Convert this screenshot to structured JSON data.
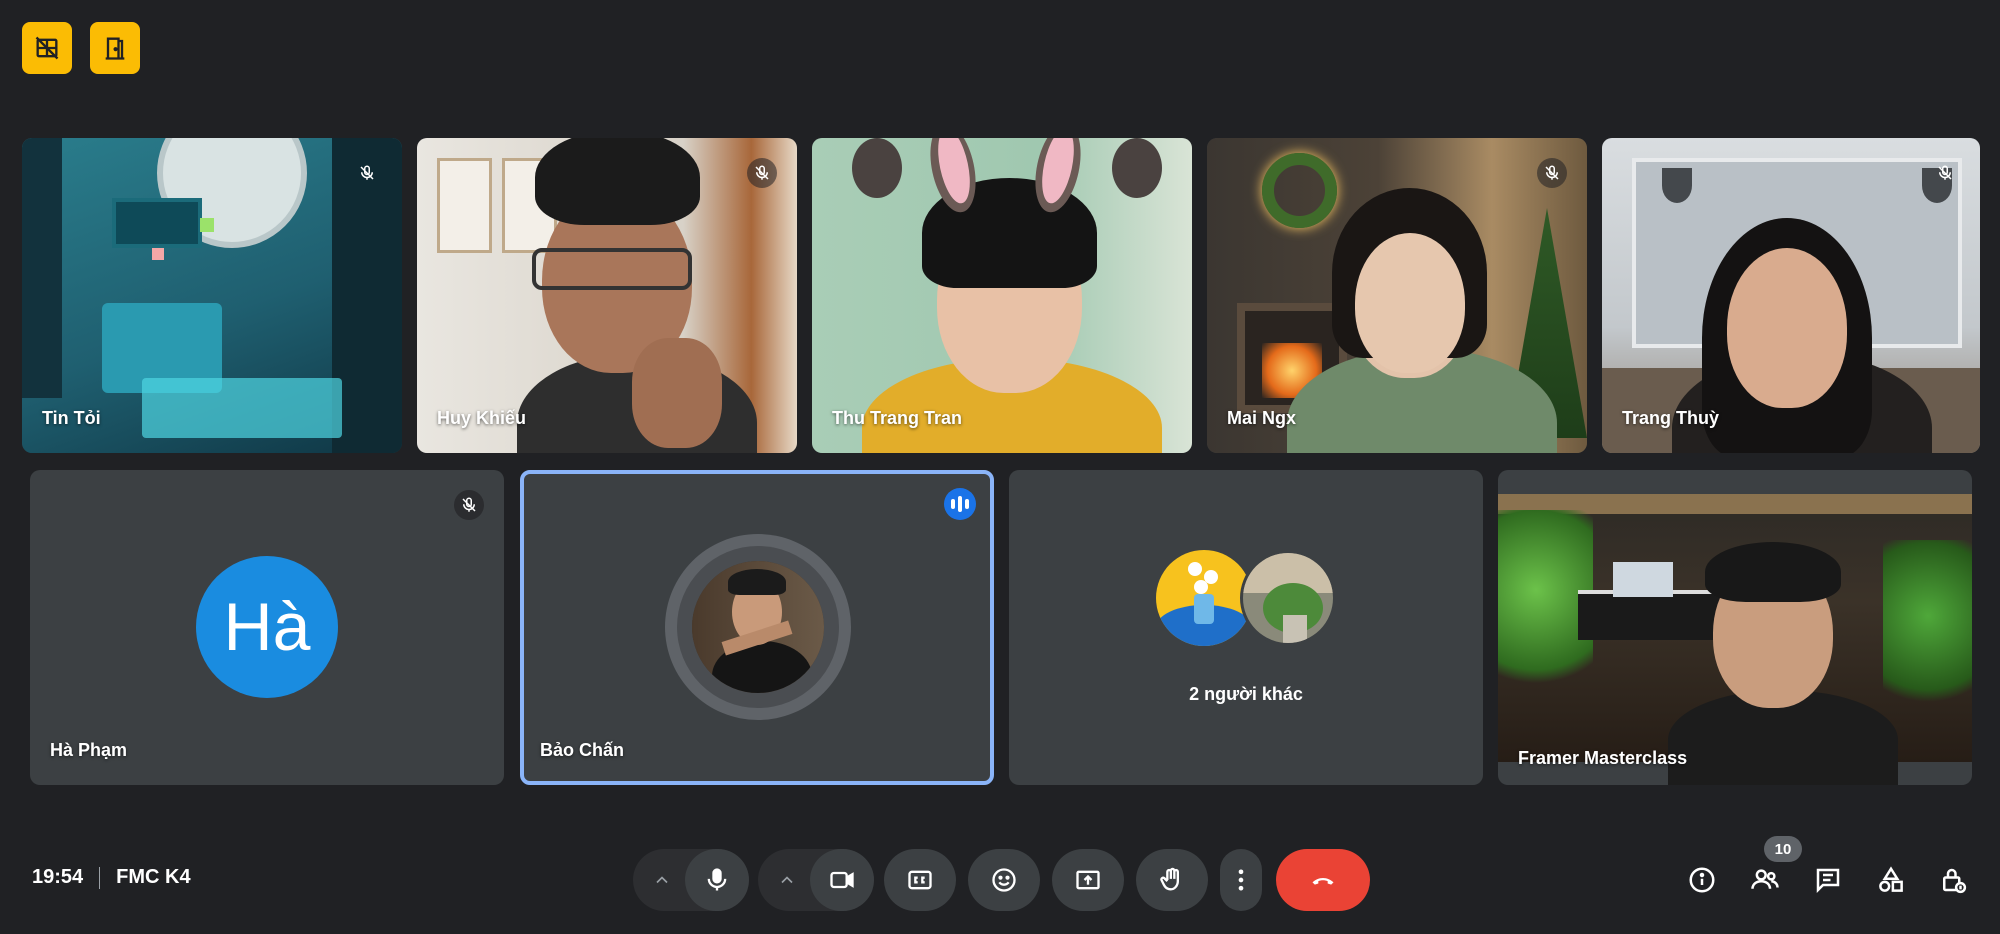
{
  "meeting": {
    "time": "19:54",
    "code": "FMC K4"
  },
  "participants_row1": [
    {
      "name": "Tin Tỏi",
      "muted": true
    },
    {
      "name": "Huy Khiếu",
      "muted": true
    },
    {
      "name": "Thu Trang Tran",
      "muted": false
    },
    {
      "name": "Mai Ngx",
      "muted": true
    },
    {
      "name": "Trang Thuỳ",
      "muted": true
    }
  ],
  "participants_row2": [
    {
      "name": "Hà Phạm",
      "initials": "Hà",
      "muted": true,
      "avatar_color": "#1a8ce0"
    },
    {
      "name": "Bảo Chấn",
      "speaking": true
    },
    {
      "label": "2 người khác"
    },
    {
      "name": "Framer Masterclass"
    }
  ],
  "people_count": "10",
  "colors": {
    "background": "#202124",
    "tile": "#3c4043",
    "accent": "#fbbc04",
    "end_call": "#ea4335",
    "speaking_border": "#8ab4f8"
  },
  "icons": {
    "top": [
      "hide-tiles-icon",
      "exit-door-icon"
    ],
    "controls": [
      "chevron-up-icon",
      "mic-icon",
      "chevron-up-icon",
      "camera-icon",
      "captions-icon",
      "emoji-icon",
      "present-icon",
      "raise-hand-icon",
      "more-icon",
      "end-call-icon"
    ],
    "right": [
      "info-icon",
      "people-icon",
      "chat-icon",
      "activities-icon",
      "host-controls-icon"
    ]
  }
}
